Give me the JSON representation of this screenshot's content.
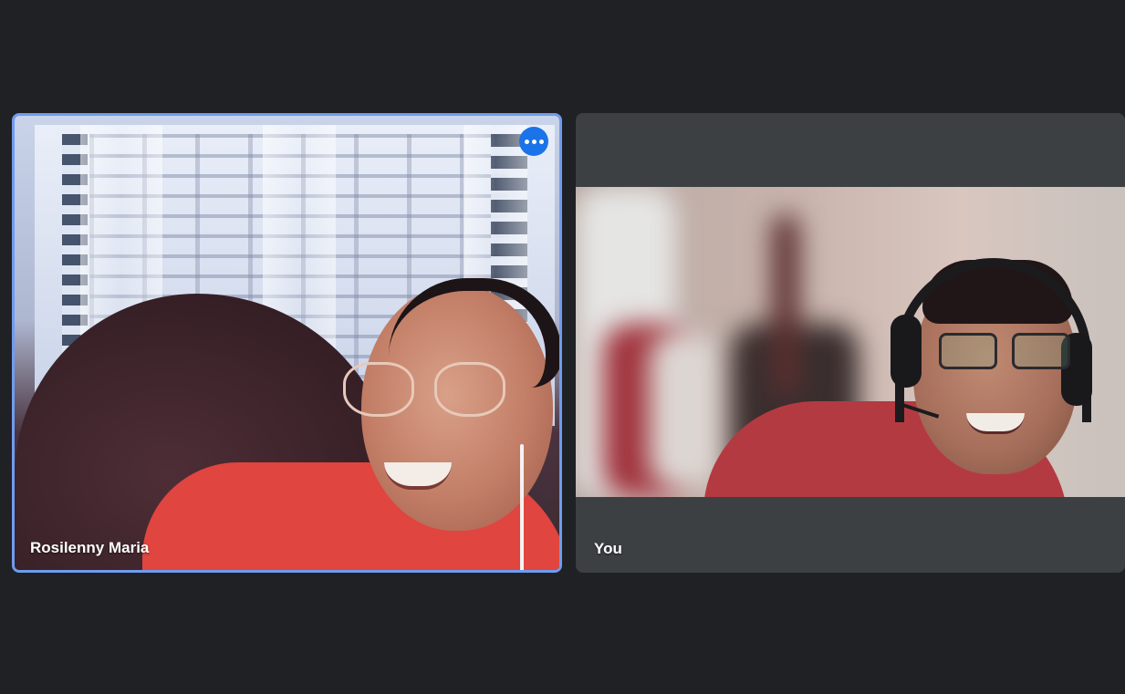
{
  "participants": [
    {
      "name": "Rosilenny Maria",
      "active_speaker": true,
      "more_options_icon": "more-horizontal-icon"
    },
    {
      "name": "You",
      "active_speaker": false
    }
  ],
  "colors": {
    "background": "#202124",
    "tile": "#3c4043",
    "active_border": "#8ab4f8",
    "more_button": "#1a73e8"
  }
}
